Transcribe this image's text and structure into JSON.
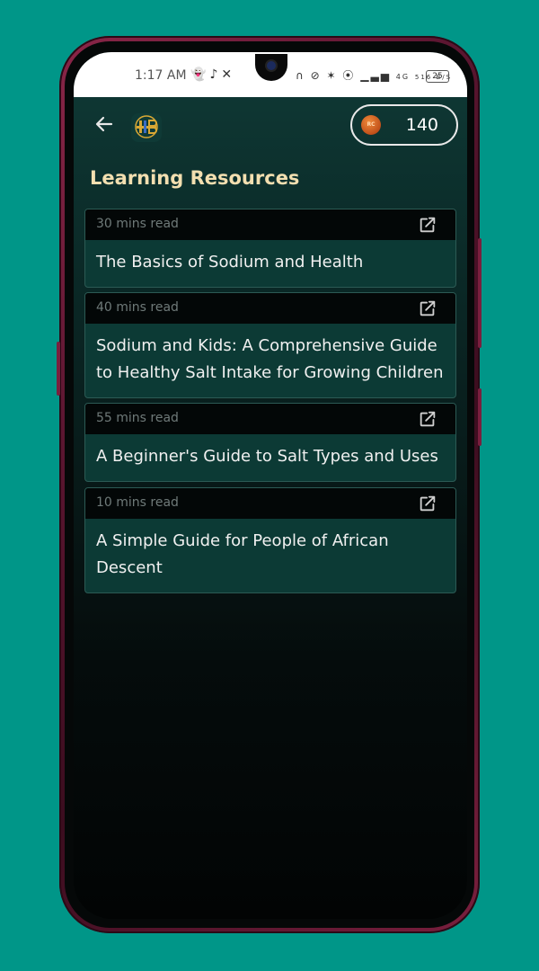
{
  "status_bar": {
    "time": "1:17 AM",
    "left_icons": [
      "snapchat-icon",
      "tiktok-icon",
      "x-icon"
    ],
    "right_icons": [
      "headphones-icon",
      "mute-icon",
      "bluetooth-icon",
      "hotspot-icon",
      "signal-icon",
      "4g-signal-icon"
    ],
    "network_type": "4G",
    "data_speed": "516 B/S",
    "battery": "25"
  },
  "header": {
    "back_icon": "arrow-left-icon",
    "logo_icon": "app-logo-icon",
    "coin_icon": "coin-icon",
    "coin_badge": "RC",
    "coin_count": "140"
  },
  "page": {
    "title": "Learning Resources"
  },
  "resources": [
    {
      "read_time": "30 mins read",
      "title": "The Basics of Sodium and Health",
      "icon": "external-link-icon"
    },
    {
      "read_time": "40 mins read",
      "title": "Sodium and Kids: A Comprehensive Guide to Healthy Salt Intake for Growing Children",
      "icon": "external-link-icon"
    },
    {
      "read_time": "55 mins read",
      "title": "A Beginner's Guide to Salt Types and Uses",
      "icon": "external-link-icon"
    },
    {
      "read_time": "10 mins read",
      "title": "A Simple Guide for People of African Descent",
      "icon": "external-link-icon"
    }
  ],
  "colors": {
    "background": "#009688",
    "frame": "#7a1f3e",
    "title": "#f3dfb0",
    "card": "#0c3a35",
    "card_header": "#030707"
  }
}
